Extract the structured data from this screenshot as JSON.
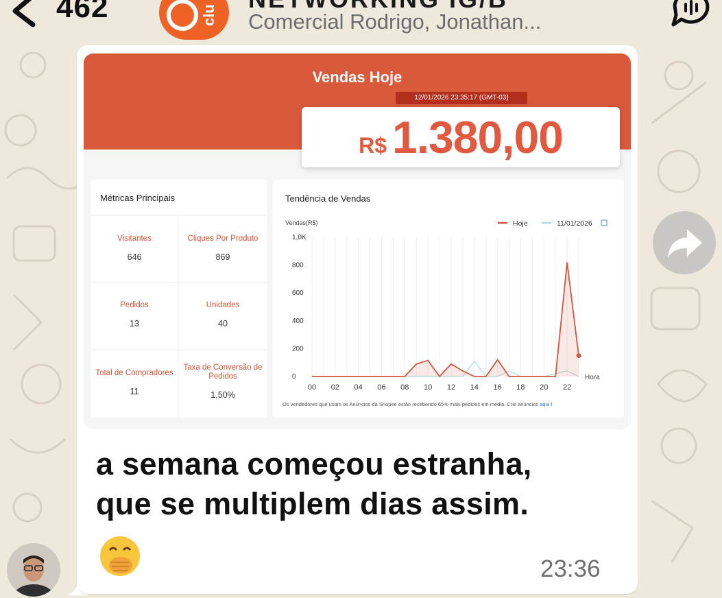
{
  "header": {
    "unread_count": "462",
    "group_name": "NETWORKING IG/B",
    "group_members": "Comercial Rodrigo, Jonathan...",
    "avatar_text": "clu"
  },
  "report": {
    "title": "Vendas Hoje",
    "timestamp": "12/01/2026 23:35:17 (GMT-03)",
    "currency": "R$",
    "total": "1.380,00",
    "metrics_title": "Métricas Principais",
    "metrics": [
      {
        "label": "Visitantes",
        "value": "646"
      },
      {
        "label": "Cliques Por Produto",
        "value": "869"
      },
      {
        "label": "Pedidos",
        "value": "13"
      },
      {
        "label": "Unidades",
        "value": "40"
      },
      {
        "label": "Total de Compradores",
        "value": "11"
      },
      {
        "label": "Taxa de Conversão de Pedidos",
        "value": "1,50%"
      }
    ],
    "trend_title": "Tendência de Vendas",
    "footnote": "Os vendedores que usam os Anúncios da Shopee estão recebendo 65% mais pedidos em média. Crie anúncios ",
    "footnote_link": "aqui",
    "footnote_end": " !"
  },
  "chart_data": {
    "type": "line",
    "ylabel": "Vendas(R$)",
    "xlabel": "Hora",
    "x": [
      0,
      1,
      2,
      3,
      4,
      5,
      6,
      7,
      8,
      9,
      10,
      11,
      12,
      13,
      14,
      15,
      16,
      17,
      18,
      19,
      20,
      21,
      22,
      23
    ],
    "xticks": [
      "00",
      "02",
      "04",
      "06",
      "08",
      "10",
      "12",
      "14",
      "16",
      "18",
      "20",
      "22"
    ],
    "yticks": [
      "0",
      "200",
      "400",
      "600",
      "800",
      "1,0K"
    ],
    "ylim": [
      0,
      1000
    ],
    "series": [
      {
        "name": "Hoje",
        "color": "#d4553d",
        "values": [
          0,
          0,
          0,
          0,
          0,
          0,
          0,
          0,
          0,
          90,
          115,
          0,
          90,
          40,
          0,
          0,
          120,
          0,
          0,
          0,
          0,
          0,
          820,
          150
        ]
      },
      {
        "name": "11/01/2026",
        "color": "#a8dfe0",
        "values": [
          0,
          0,
          0,
          0,
          0,
          0,
          0,
          0,
          0,
          0,
          0,
          0,
          0,
          0,
          110,
          0,
          0,
          40,
          0,
          0,
          0,
          20,
          40,
          0
        ]
      }
    ],
    "legend": "top-right",
    "grid": true
  },
  "message": {
    "text_line1": "a semana começou estranha,",
    "text_line2": "que se multiplem dias assim.",
    "time": "23:36"
  },
  "colors": {
    "brand": "#ee6226",
    "report_accent": "#d95a3b",
    "wallpaper": "#efe8dc"
  },
  "icons": [
    "back-chevron-icon",
    "call-icon",
    "forward-icon",
    "calendar-icon"
  ]
}
